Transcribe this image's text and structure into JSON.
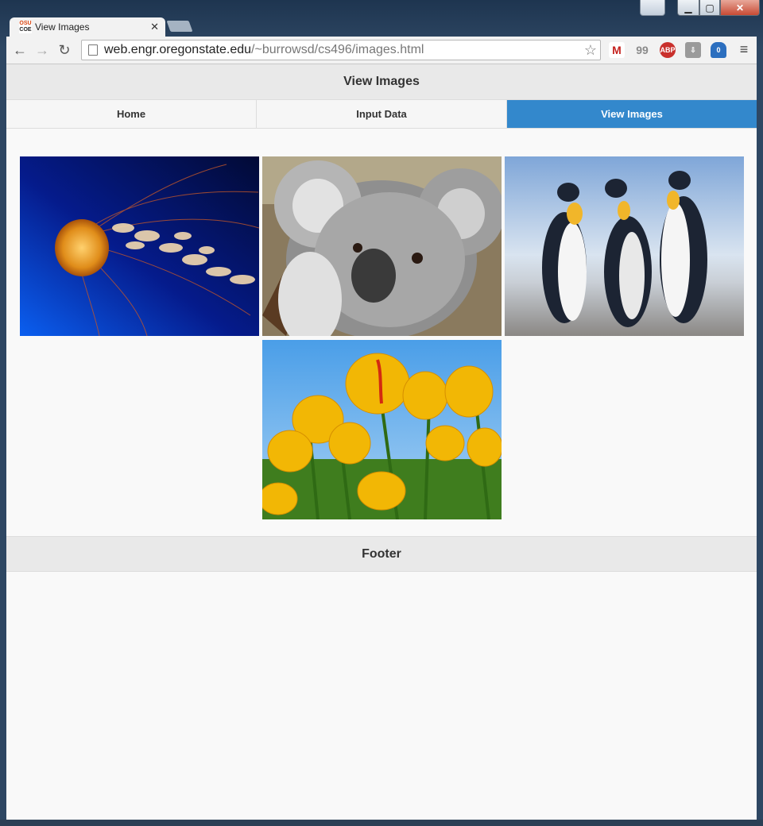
{
  "browser": {
    "tab_title": "View Images",
    "favicon_text_top": "OSU",
    "favicon_text_bottom": "COE",
    "url_host": "web.engr.oregonstate.edu",
    "url_path": "/~burrowsd/cs496/images.html",
    "extensions": [
      {
        "name": "gmail",
        "text": "M",
        "color": "#c5221f"
      },
      {
        "name": "quote",
        "text": "99",
        "color": "#8a8a8a"
      },
      {
        "name": "adblock",
        "text": "ABP",
        "color": "#c9302c"
      },
      {
        "name": "download",
        "text": "⇩",
        "color": "#8a8a8a"
      },
      {
        "name": "ghostery",
        "text": "0",
        "color": "#2c6fbf"
      }
    ]
  },
  "page": {
    "header_title": "View Images",
    "nav": [
      {
        "label": "Home",
        "active": false
      },
      {
        "label": "Input Data",
        "active": false
      },
      {
        "label": "View Images",
        "active": true
      }
    ],
    "images": [
      "jellyfish",
      "koala",
      "penguins",
      "tulips"
    ],
    "footer_title": "Footer"
  },
  "colors": {
    "nav_active": "#3388cc",
    "header_bg": "#e9e9e9",
    "page_bg": "#f9f9f9"
  }
}
